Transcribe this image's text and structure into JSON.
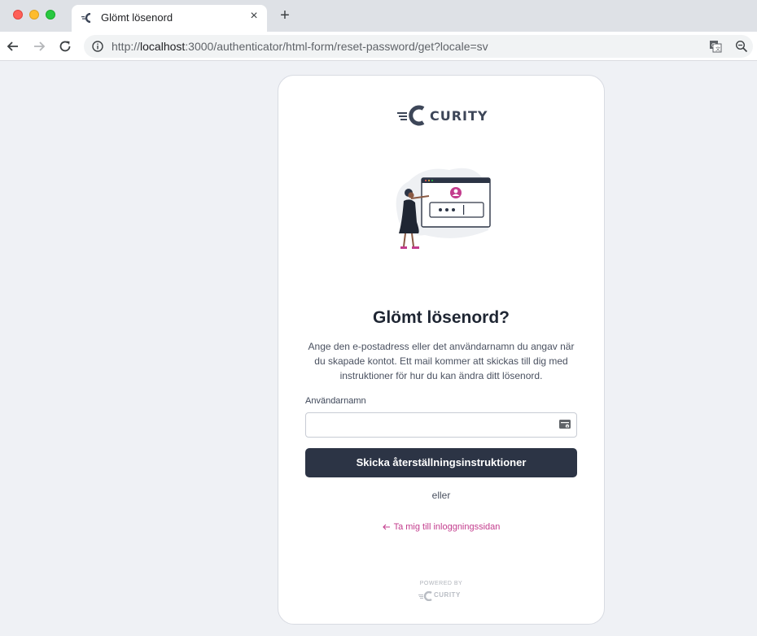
{
  "browser": {
    "tab_title": "Glömt lösenord",
    "tab_close": "×",
    "new_tab": "+",
    "url_prefix": "http://",
    "url_host": "localhost",
    "url_rest": ":3000/authenticator/html-form/reset-password/get?locale=sv"
  },
  "brand": {
    "logo_text": "CURITY",
    "accent_color": "#c33c8d",
    "dark_color": "#2c3445"
  },
  "form": {
    "heading": "Glömt lösenord?",
    "description": "Ange den e-postadress eller det användarnamn du angav när du skapade kontot. Ett mail kommer att skickas till dig med instruktioner för hur du kan ändra ditt lösenord.",
    "username_label": "Användarnamn",
    "username_value": "",
    "submit_label": "Skicka återställningsinstruktioner",
    "or_text": "eller",
    "back_link_text": "Ta mig till inloggningssidan"
  },
  "footer": {
    "powered_by": "POWERED BY",
    "logo_text": "CURITY"
  },
  "icons": {
    "back": "arrow-left-icon",
    "forward": "arrow-right-icon",
    "reload": "reload-icon",
    "info": "info-icon",
    "translate": "translate-icon",
    "zoom": "zoom-out-icon",
    "autofill": "autofill-key-icon"
  }
}
